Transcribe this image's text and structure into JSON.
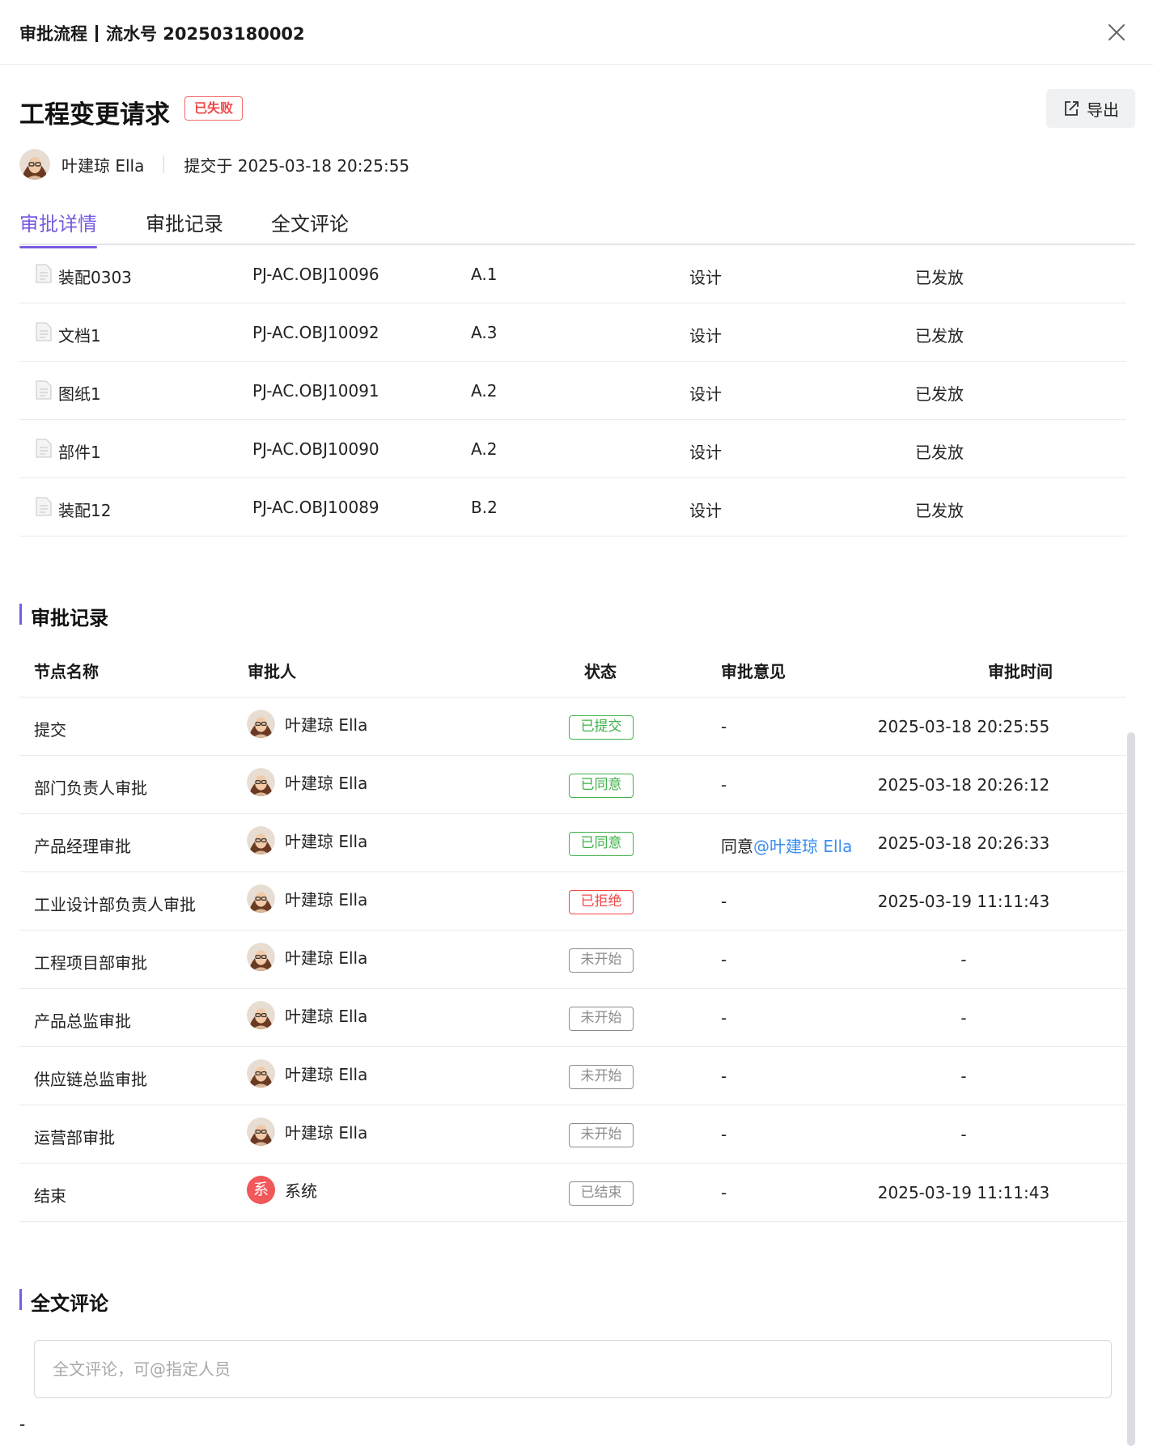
{
  "header": {
    "title": "审批流程",
    "serial_label": "流水号 202503180002"
  },
  "request": {
    "title": "工程变更请求",
    "status": "已失败",
    "export_label": "导出",
    "submitter": "叶建琼 Ella",
    "submitted_at": "提交于 2025-03-18 20:25:55"
  },
  "tabs": [
    {
      "label": "审批详情",
      "active": true
    },
    {
      "label": "审批记录",
      "active": false
    },
    {
      "label": "全文评论",
      "active": false
    }
  ],
  "objects": [
    {
      "name": "装配0303",
      "code": "PJ-AC.OBJ10096",
      "version": "A.1",
      "stage": "设计",
      "state": "已发放"
    },
    {
      "name": "文档1",
      "code": "PJ-AC.OBJ10092",
      "version": "A.3",
      "stage": "设计",
      "state": "已发放"
    },
    {
      "name": "图纸1",
      "code": "PJ-AC.OBJ10091",
      "version": "A.2",
      "stage": "设计",
      "state": "已发放"
    },
    {
      "name": "部件1",
      "code": "PJ-AC.OBJ10090",
      "version": "A.2",
      "stage": "设计",
      "state": "已发放"
    },
    {
      "name": "装配12",
      "code": "PJ-AC.OBJ10089",
      "version": "B.2",
      "stage": "设计",
      "state": "已发放"
    }
  ],
  "records": {
    "title": "审批记录",
    "columns": {
      "node": "节点名称",
      "approver": "审批人",
      "status": "状态",
      "opinion": "审批意见",
      "time": "审批时间"
    },
    "rows": [
      {
        "node": "提交",
        "approver": "叶建琼 Ella",
        "status": "已提交",
        "tone": "green",
        "opinion": "-",
        "mention": "",
        "time": "2025-03-18 20:25:55"
      },
      {
        "node": "部门负责人审批",
        "approver": "叶建琼 Ella",
        "status": "已同意",
        "tone": "green",
        "opinion": "-",
        "mention": "",
        "time": "2025-03-18 20:26:12"
      },
      {
        "node": "产品经理审批",
        "approver": "叶建琼 Ella",
        "status": "已同意",
        "tone": "green",
        "opinion": "同意",
        "mention": "@叶建琼 Ella",
        "time": "2025-03-18 20:26:33"
      },
      {
        "node": "工业设计部负责人审批",
        "approver": "叶建琼 Ella",
        "status": "已拒绝",
        "tone": "red",
        "opinion": "-",
        "mention": "",
        "time": "2025-03-19 11:11:43"
      },
      {
        "node": "工程项目部审批",
        "approver": "叶建琼 Ella",
        "status": "未开始",
        "tone": "gray",
        "opinion": "-",
        "mention": "",
        "time": "-"
      },
      {
        "node": "产品总监审批",
        "approver": "叶建琼 Ella",
        "status": "未开始",
        "tone": "gray",
        "opinion": "-",
        "mention": "",
        "time": "-"
      },
      {
        "node": "供应链总监审批",
        "approver": "叶建琼 Ella",
        "status": "未开始",
        "tone": "gray",
        "opinion": "-",
        "mention": "",
        "time": "-"
      },
      {
        "node": "运营部审批",
        "approver": "叶建琼 Ella",
        "status": "未开始",
        "tone": "gray",
        "opinion": "-",
        "mention": "",
        "time": "-"
      },
      {
        "node": "结束",
        "approver": "系统",
        "system_avatar": "系",
        "status": "已结束",
        "tone": "gray",
        "opinion": "-",
        "mention": "",
        "time": "2025-03-19 11:11:43"
      }
    ]
  },
  "comments": {
    "title": "全文评论",
    "placeholder": "全文评论，可@指定人员",
    "value": "",
    "footer": "-"
  },
  "colors": {
    "accent": "#7a5ce0",
    "status_green": "#3fb24a",
    "status_red": "#f04848",
    "status_gray": "#8c8c8c",
    "mention": "#3a8df0"
  },
  "icons": {
    "close": "close-icon",
    "export": "export-icon",
    "document": "document-icon",
    "avatar": "avatar-photo"
  }
}
